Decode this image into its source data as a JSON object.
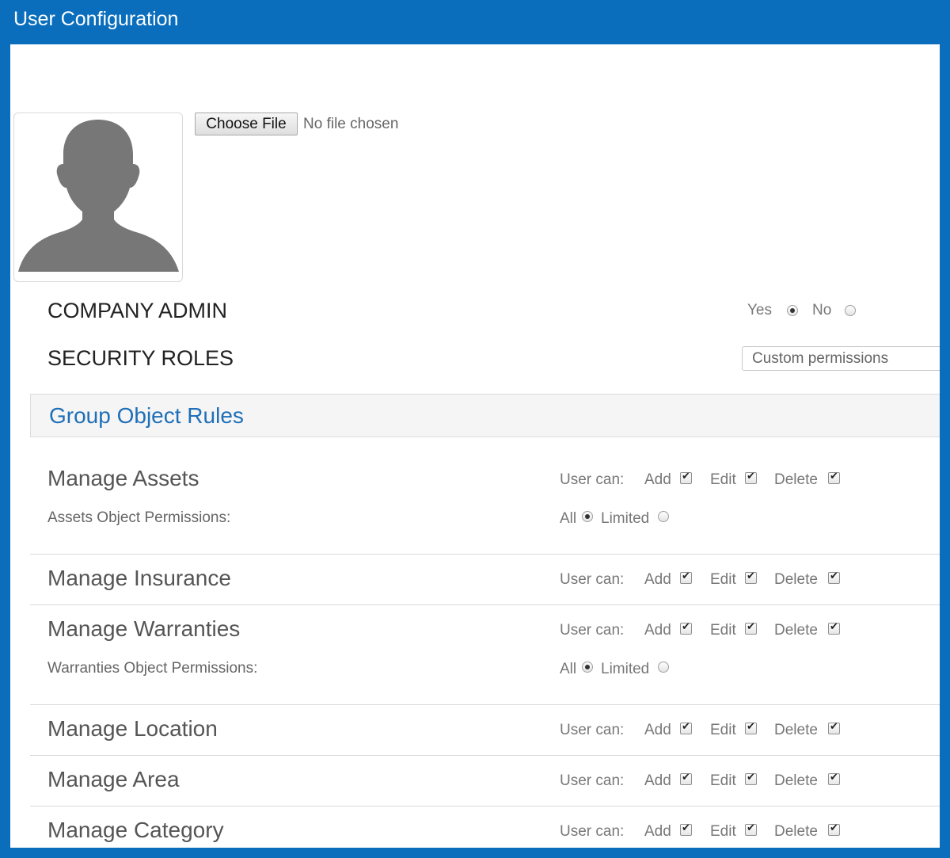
{
  "window": {
    "title": "User Configuration"
  },
  "avatar": {
    "icon": "user-silhouette-icon",
    "color": "#777777"
  },
  "file_input": {
    "button_label": "Choose File",
    "status": "No file chosen"
  },
  "company_admin": {
    "label": "COMPANY ADMIN",
    "yes_label": "Yes",
    "no_label": "No",
    "selected": "Yes"
  },
  "security_roles": {
    "label": "SECURITY ROLES",
    "selected_value": "Custom permissions"
  },
  "group_object_rules": {
    "title": "Group Object Rules",
    "user_can_label": "User can:",
    "add_label": "Add",
    "edit_label": "Edit",
    "delete_label": "Delete",
    "all_label": "All",
    "limited_label": "Limited",
    "sections": [
      {
        "title": "Manage Assets",
        "add": true,
        "edit": true,
        "delete": true,
        "object_permissions_label": "Assets Object Permissions:",
        "scope": "All"
      },
      {
        "title": "Manage Insurance",
        "add": true,
        "edit": true,
        "delete": true
      },
      {
        "title": "Manage Warranties",
        "add": true,
        "edit": true,
        "delete": true,
        "object_permissions_label": "Warranties Object Permissions:",
        "scope": "All"
      },
      {
        "title": "Manage Location",
        "add": true,
        "edit": true,
        "delete": true
      },
      {
        "title": "Manage Area",
        "add": true,
        "edit": true,
        "delete": true
      },
      {
        "title": "Manage Category",
        "add": true,
        "edit": true,
        "delete": true
      }
    ]
  },
  "colors": {
    "title_bar": "#0a6ebd",
    "section_title": "#1f6fb8"
  }
}
